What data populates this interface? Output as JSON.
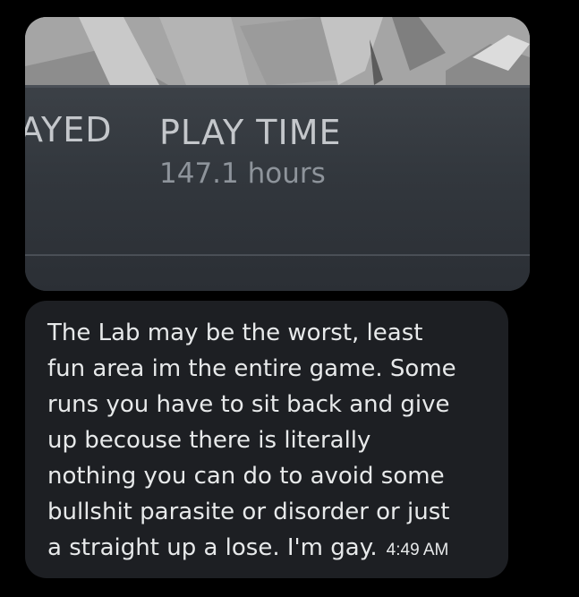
{
  "attachment": {
    "stat_label_partial": "AYED",
    "stat_label": "PLAY TIME",
    "stat_value": "147.1 hours"
  },
  "message": {
    "text": "The Lab may be the worst, least\nfun area im the entire game. Some\nruns you have to sit back and give\nup becouse there is literally\nnothing you can do to avoid some\nbullshit parasite or disorder or just\na straight up a lose. I'm gay.",
    "time": "4:49 AM"
  },
  "colors": {
    "background": "#000000",
    "bubble": "#1d1f23",
    "text": "#e7e9ea",
    "stat_label": "#c4c7cb",
    "stat_value": "#8e949b"
  }
}
